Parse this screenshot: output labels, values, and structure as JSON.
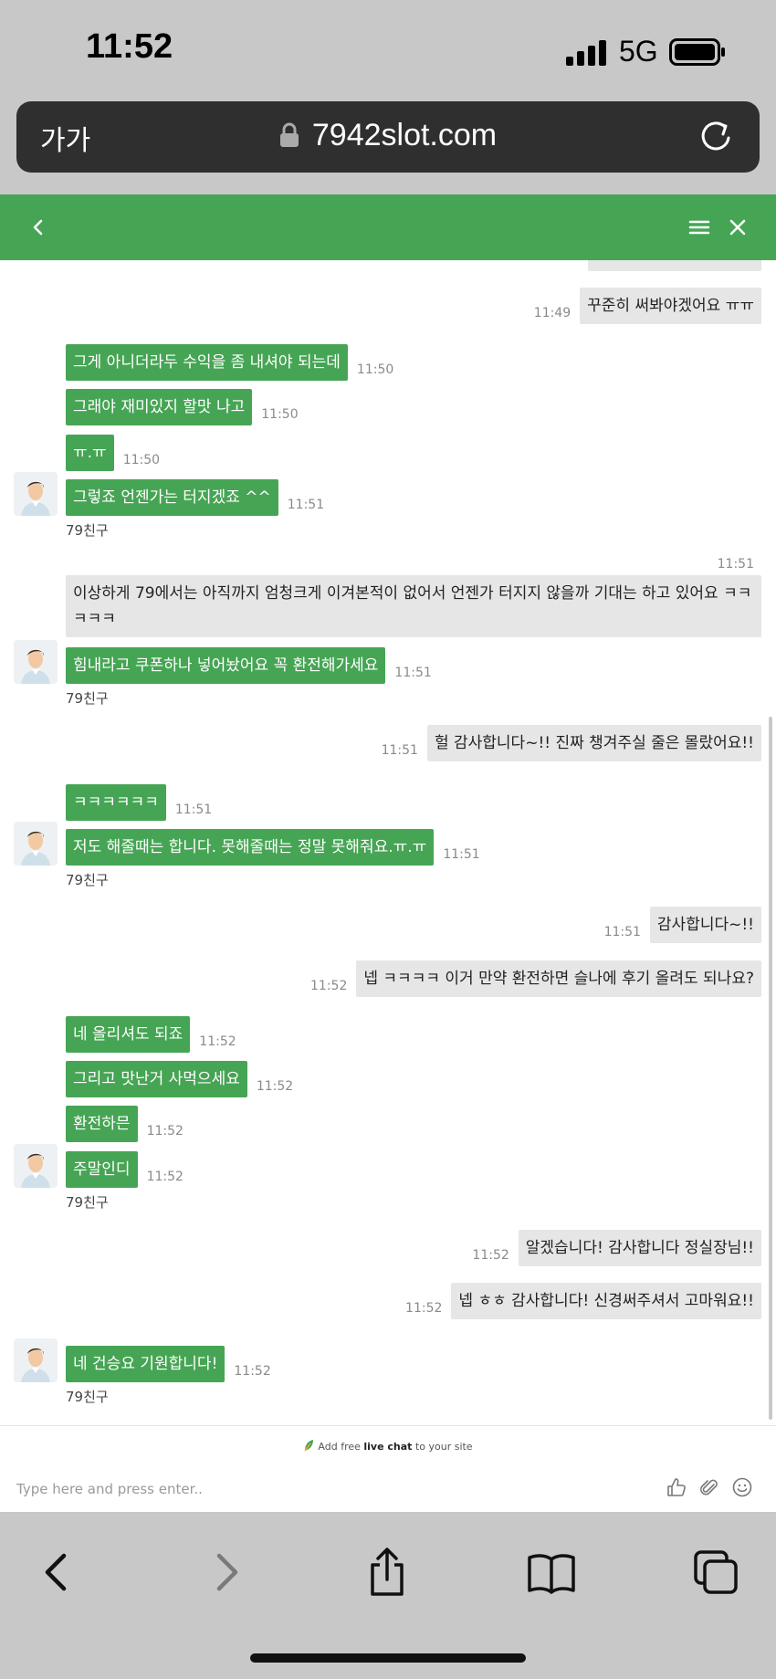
{
  "status_bar": {
    "time": "11:52",
    "network": "5G"
  },
  "browser": {
    "text_size_label": "가가",
    "url": "7942slot.com"
  },
  "chat": {
    "agent_name": "79친구",
    "messages": [
      {
        "from": "user",
        "text": "꾸준히 써봐야겠어요 ㅠㅠ",
        "time": "11:49"
      },
      {
        "from": "agent",
        "text": "그게 아니더라두 수익을 좀 내셔야 되는데",
        "time": "11:50"
      },
      {
        "from": "agent",
        "text": "그래야 재미있지 할맛 나고",
        "time": "11:50"
      },
      {
        "from": "agent",
        "text": "ㅠ.ㅠ",
        "time": "11:50"
      },
      {
        "from": "agent",
        "text": "그렇죠 언젠가는 터지겠죠 ^^",
        "time": "11:51"
      },
      {
        "from": "user",
        "text": "이상하게 79에서는 아직까지 엄청크게 이겨본적이 없어서 언젠가 터지지 않을까 기대는 하고 있어요 ㅋㅋ ㅋㅋㅋ",
        "time": "11:51"
      },
      {
        "from": "agent",
        "text": "힘내라고 쿠폰하나 넣어놨어요 꼭 환전해가세요",
        "time": "11:51"
      },
      {
        "from": "user",
        "text": "헐 감사합니다~!! 진짜 챙겨주실 줄은 몰랐어요!!",
        "time": "11:51"
      },
      {
        "from": "agent",
        "text": "ㅋㅋㅋㅋㅋㅋ",
        "time": "11:51"
      },
      {
        "from": "agent",
        "text": "저도 해줄때는 합니다. 못해줄때는 정말 못해줘요.ㅠ.ㅠ",
        "time": "11:51"
      },
      {
        "from": "user",
        "text": "감사합니다~!!",
        "time": "11:51"
      },
      {
        "from": "user",
        "text": "넵 ㅋㅋㅋㅋ 이거 만약 환전하면 슬나에 후기 올려도 되나요?",
        "time": "11:52"
      },
      {
        "from": "agent",
        "text": "네 올리셔도 되죠",
        "time": "11:52"
      },
      {
        "from": "agent",
        "text": "그리고 맛난거 사먹으세요",
        "time": "11:52"
      },
      {
        "from": "agent",
        "text": "환전하믄",
        "time": "11:52"
      },
      {
        "from": "agent",
        "text": "주말인디",
        "time": "11:52"
      },
      {
        "from": "user",
        "text": "알겠습니다! 감사합니다 정실장님!!",
        "time": "11:52"
      },
      {
        "from": "user",
        "text": "넵 ㅎㅎ 감사합니다! 신경써주셔서 고마워요!!",
        "time": "11:52"
      },
      {
        "from": "agent",
        "text": "네 건승요 기원합니다!",
        "time": "11:52"
      }
    ],
    "promo": {
      "prefix": "Add free",
      "bold": "live chat",
      "suffix": "to your site"
    },
    "input_placeholder": "Type here and press enter..",
    "colors": {
      "accent": "#46a554",
      "user_bubble": "#e6e6e6"
    }
  },
  "icons": {
    "header": [
      "back-icon",
      "menu-icon",
      "close-icon"
    ],
    "input": [
      "thumbs-up-icon",
      "paperclip-icon",
      "emoji-icon"
    ],
    "toolbar": [
      "back-arrow-icon",
      "forward-arrow-icon",
      "share-icon",
      "bookmarks-icon",
      "tabs-icon"
    ]
  }
}
